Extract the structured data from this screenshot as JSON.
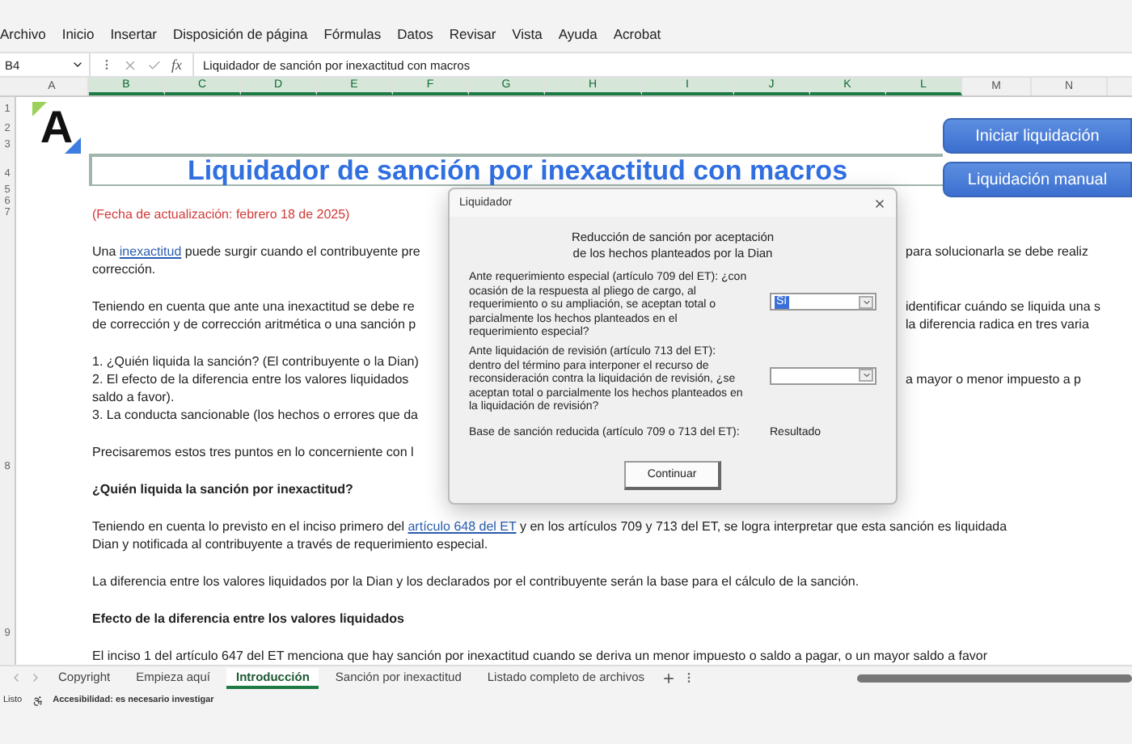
{
  "menu": [
    "Archivo",
    "Inicio",
    "Insertar",
    "Disposición de página",
    "Fórmulas",
    "Datos",
    "Revisar",
    "Vista",
    "Ayuda",
    "Acrobat"
  ],
  "formula_bar": {
    "name_box": "B4",
    "fx": "fx",
    "formula": "Liquidador de sanción por inexactitud con macros"
  },
  "columns": [
    {
      "label": "A",
      "selected": false
    },
    {
      "label": "B",
      "selected": true
    },
    {
      "label": "C",
      "selected": true
    },
    {
      "label": "D",
      "selected": true
    },
    {
      "label": "E",
      "selected": true
    },
    {
      "label": "F",
      "selected": true
    },
    {
      "label": "G",
      "selected": true
    },
    {
      "label": "H",
      "selected": true
    },
    {
      "label": "I",
      "selected": true
    },
    {
      "label": "J",
      "selected": true
    },
    {
      "label": "K",
      "selected": true
    },
    {
      "label": "L",
      "selected": true
    },
    {
      "label": "M",
      "selected": false
    },
    {
      "label": "N",
      "selected": false
    }
  ],
  "rows": [
    "1",
    "2",
    "3",
    "4",
    "5",
    "6",
    "7",
    "8",
    "9"
  ],
  "sheet": {
    "logo_text": "A",
    "title": "Liquidador de sanción por inexactitud con macros",
    "buttons": [
      "Iniciar liquidación",
      "Liquidación manual"
    ],
    "blocks": [
      {
        "kind": "date",
        "lines": [
          {
            "left": [
              {
                "text": "(Fecha de actualización: febrero 18 de 2025)",
                "kind": "text"
              }
            ]
          }
        ]
      },
      {
        "kind": "text",
        "lines": [
          {
            "left": [
              {
                "text": "Una ",
                "kind": "text"
              },
              {
                "text": "inexactitud",
                "kind": "link"
              },
              {
                "text": " puede surgir cuando el contribuyente pre",
                "kind": "text"
              }
            ],
            "right": "para solucionarla se debe realiz"
          },
          {
            "left": [
              {
                "text": "corrección.",
                "kind": "text"
              }
            ]
          }
        ]
      },
      {
        "kind": "text",
        "lines": [
          {
            "left": [
              {
                "text": "Teniendo en cuenta que ante una inexactitud se debe re",
                "kind": "text"
              }
            ],
            "right": "identificar cuándo se liquida una s"
          },
          {
            "left": [
              {
                "text": "de corrección y de corrección aritmética o una sanción p",
                "kind": "text"
              }
            ],
            "right": "la diferencia radica en tres varia"
          }
        ]
      },
      {
        "kind": "text",
        "lines": [
          {
            "left": [
              {
                "text": "1. ¿Quién liquida la sanción? (El contribuyente o la Dian)",
                "kind": "text"
              }
            ]
          },
          {
            "left": [
              {
                "text": "2. El efecto de la diferencia entre los valores liquidados",
                "kind": "text"
              }
            ],
            "right": "a mayor o menor impuesto a p"
          },
          {
            "left": [
              {
                "text": "saldo a favor).",
                "kind": "text"
              }
            ]
          },
          {
            "left": [
              {
                "text": "3. La conducta sancionable (los hechos o errores que da",
                "kind": "text"
              }
            ]
          }
        ]
      },
      {
        "kind": "text",
        "lines": [
          {
            "left": [
              {
                "text": "Precisaremos estos tres puntos en lo concerniente con l",
                "kind": "text"
              }
            ]
          }
        ]
      },
      {
        "kind": "heading",
        "lines": [
          {
            "left": [
              {
                "text": "¿Quién liquida la sanción por inexactitud?",
                "kind": "text"
              }
            ]
          }
        ]
      },
      {
        "kind": "text",
        "lines": [
          {
            "left": [
              {
                "text": "Teniendo en cuenta lo previsto en el inciso primero del ",
                "kind": "text"
              },
              {
                "text": "artículo 648 del ET",
                "kind": "link"
              },
              {
                "text": " y en los artículos 709 y 713 del ET, se logra interpretar que esta sanción es liquidada",
                "kind": "text"
              }
            ]
          },
          {
            "left": [
              {
                "text": "Dian y notificada al contribuyente a través de requerimiento especial.",
                "kind": "text"
              }
            ]
          }
        ]
      },
      {
        "kind": "text",
        "lines": [
          {
            "left": [
              {
                "text": "La diferencia entre los valores liquidados por la Dian y los declarados por el contribuyente serán la base para el cálculo de la sanción.",
                "kind": "text"
              }
            ]
          }
        ]
      },
      {
        "kind": "heading",
        "lines": [
          {
            "left": [
              {
                "text": "Efecto de la diferencia entre los valores liquidados",
                "kind": "text"
              }
            ]
          }
        ]
      },
      {
        "kind": "text",
        "lines": [
          {
            "left": [
              {
                "text": "El inciso 1 del artículo 647 del ET menciona que hay sanción por inexactitud cuando se deriva un menor impuesto o saldo a pagar, o un mayor saldo a favor",
                "kind": "text"
              }
            ]
          }
        ]
      }
    ]
  },
  "dialog": {
    "title": "Liquidador",
    "heading": "Reducción de sanción por aceptación de los hechos planteados por la Dian",
    "questions": [
      {
        "text": "Ante requerimiento especial (artículo 709 del ET): ¿con ocasión de la respuesta al pliego de cargo, al requerimiento o su ampliación, se aceptan total o parcialmente los hechos planteados en el requerimiento especial?",
        "value": "Sí"
      },
      {
        "text": "Ante liquidación de revisión (artículo 713 del ET): dentro del término para interponer el recurso de reconsideración contra la liquidación de revisión, ¿se aceptan total o parcialmente los hechos planteados en la liquidación de revisión?"
      }
    ],
    "result_label": "Base de sanción reducida (artículo 709 o 713 del ET):",
    "result": "Resultado",
    "button": "Continuar"
  },
  "sheet_tabs": [
    {
      "label": "Copyright",
      "selected": false
    },
    {
      "label": "Empieza aquí",
      "selected": false
    },
    {
      "label": "Introducción",
      "selected": true
    },
    {
      "label": "Sanción por inexactitud",
      "selected": false
    },
    {
      "label": "Listado completo de archivos",
      "selected": false
    }
  ],
  "status_bar": {
    "state": "Listo",
    "accessibility": "Accesibilidad: es necesario investigar"
  }
}
